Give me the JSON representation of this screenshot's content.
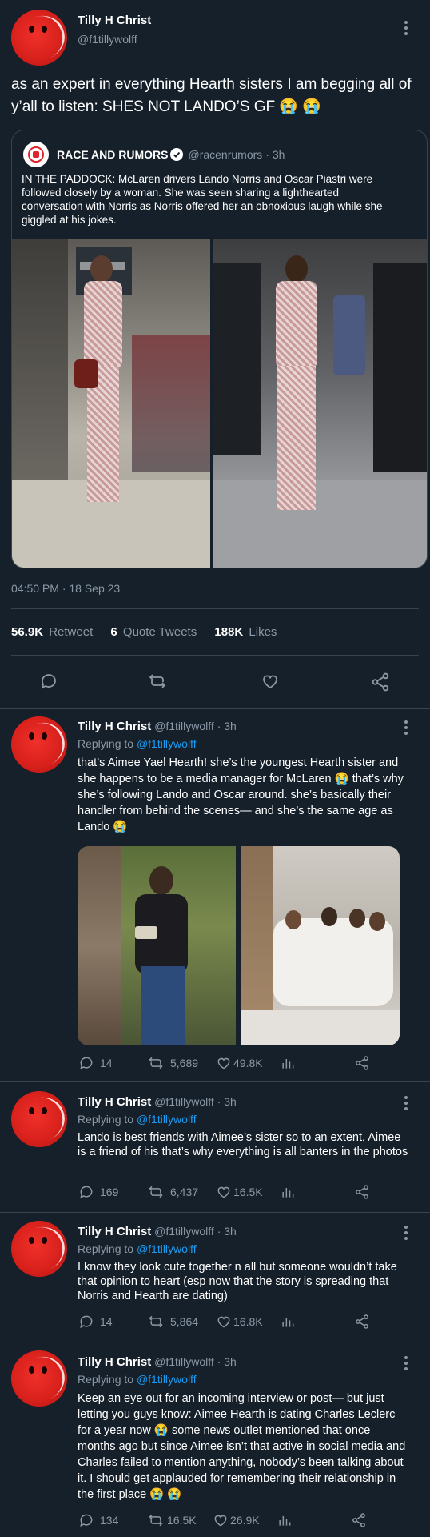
{
  "main_tweet": {
    "name": "Tilly H Christ",
    "handle": "@f1tillywolff",
    "text": "as an expert in everything Hearth sisters I am begging all of y’all to listen: SHES NOT LANDO’S GF 😭 😭",
    "timestamp": "04:50 PM · 18 Sep 23",
    "quoted": {
      "name": "RACE AND RUMORS",
      "handle": "@racenrumors",
      "time": "· 3h",
      "text": "IN THE PADDOCK: McLaren drivers Lando Norris and Oscar Piastri were followed closely by a woman. She was seen sharing a lighthearted conversation with Norris as Norris offered her an obnoxious laugh while she giggled at his jokes."
    },
    "stats": {
      "retweets_count": "56.9K",
      "retweets_label": "Retweet",
      "quotes_count": "6",
      "quotes_label": "Quote Tweets",
      "likes_count": "188K",
      "likes_label": "Likes"
    }
  },
  "replies": [
    {
      "name": "Tilly H Christ",
      "handle": "@f1tillywolff",
      "time": "· 3h",
      "replying_prefix": "Replying to",
      "replying_to": "@f1tillywolff",
      "text": "that’s Aimee Yael Hearth! she’s the youngest Hearth sister and she happens to be a media manager for McLaren 😭 that’s why she’s following Lando and Oscar around. she’s basically their handler from behind the scenes— and she’s the same age as Lando 😭",
      "replies": "14",
      "retweets": "5,689",
      "likes": "49.8K"
    },
    {
      "name": "Tilly H Christ",
      "handle": "@f1tillywolff",
      "time": "· 3h",
      "replying_prefix": "Replying to",
      "replying_to": "@f1tillywolff",
      "text": "Lando is best friends with Aimee’s sister so to an extent, Aimee is a friend of his that’s why everything is all banters in the photos",
      "replies": "169",
      "retweets": "6,437",
      "likes": "16.5K"
    },
    {
      "name": "Tilly H Christ",
      "handle": "@f1tillywolff",
      "time": "· 3h",
      "replying_prefix": "Replying to",
      "replying_to": "@f1tillywolff",
      "text": "I know they look cute together n all but someone wouldn’t take that opinion to heart (esp now that the story is spreading that Norris and Hearth are dating)",
      "replies": "14",
      "retweets": "5,864",
      "likes": "16.8K"
    },
    {
      "name": "Tilly H Christ",
      "handle": "@f1tillywolff",
      "time": "· 3h",
      "replying_prefix": "Replying to",
      "replying_to": "@f1tillywolff",
      "text": "Keep an eye out for an incoming interview or post— but just letting you guys know: Aimee Hearth is dating Charles Leclerc for a year now 😭 some news outlet mentioned that once months ago but since Aimee isn’t that active in social media and Charles failed to mention anything, nobody’s been talking about it. I should get applauded for remembering their relationship in the first place 😭 😭",
      "replies": "134",
      "retweets": "16.5K",
      "likes": "26.9K"
    }
  ]
}
